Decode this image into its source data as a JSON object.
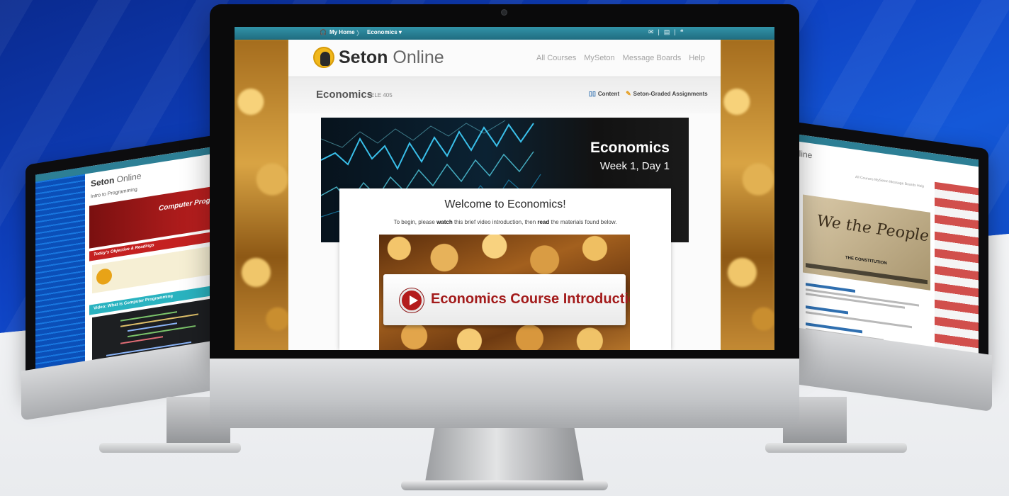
{
  "main": {
    "topnav": {
      "home_label": "My Home",
      "separator": "〉",
      "course_label": "Economics ▾",
      "icons": [
        "chat-icon",
        "divider",
        "book-icon",
        "divider",
        "message-icon"
      ]
    },
    "header": {
      "logo_bold": "Seton",
      "logo_light": " Online",
      "links": [
        "All Courses",
        "MySeton",
        "Message Boards",
        "Help"
      ]
    },
    "course": {
      "title": "Economics",
      "code": "ELE 405",
      "content_link": "Content",
      "assignments_link": "Seton-Graded Assignments"
    },
    "hero": {
      "title": "Economics",
      "subtitle": "Week 1, Day 1"
    },
    "welcome": {
      "title": "Welcome to Economics!",
      "text_pre": "To begin, please ",
      "text_watch": "watch",
      "text_mid": " this brief video introduction, then ",
      "text_read": "read",
      "text_post": " the materials found below."
    },
    "video": {
      "title": "Economics Course Introduction"
    }
  },
  "left_monitor": {
    "logo_bold": "Seton",
    "logo_light": " Online",
    "course": "Intro to Programming",
    "banner": "Computer Progr",
    "objective": "Today's Objective & Readings",
    "video_header": "Video: What is Computer Programming"
  },
  "right_monitor": {
    "logo": "nline",
    "links": "All Courses   MySeton   Message Boards   Help",
    "video_heading": "We the People",
    "video_title": "THE CONSTITUTION"
  },
  "colors": {
    "brand_teal": "#2a8196",
    "brand_red": "#a31b1b",
    "accent_gold": "#f1b81b"
  }
}
